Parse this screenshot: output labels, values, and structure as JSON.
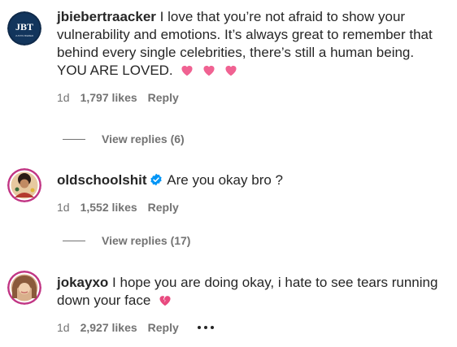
{
  "comments": [
    {
      "username": "jbiebertraacker",
      "avatar_text": "JBT",
      "avatar_subtext": "JUSTIN BIEBER",
      "text": "I love that you’re not afraid to show your vulnerability and emotions. It’s always great to remember that behind every single celebrities, there’s still a human being. YOU ARE LOVED.",
      "emoji": [
        "pink-heart-icon",
        "pink-heart-icon",
        "pink-heart-icon"
      ],
      "time": "1d",
      "likes": "1,797 likes",
      "reply_label": "Reply",
      "view_replies": "View replies (6)"
    },
    {
      "username": "oldschoolshit",
      "verified": true,
      "text": "Are you okay bro ?",
      "time": "1d",
      "likes": "1,552 likes",
      "reply_label": "Reply",
      "view_replies": "View replies (17)"
    },
    {
      "username": "jokayxo",
      "text": "I hope you are doing okay, i hate to see tears running down your face",
      "emoji": [
        "broken-heart-icon"
      ],
      "time": "1d",
      "likes": "2,927 likes",
      "reply_label": "Reply",
      "more_icon": "more-options-icon"
    }
  ],
  "colors": {
    "text": "#262626",
    "secondary": "#737373",
    "verified": "#0095f6",
    "heart_pink": "#f06292",
    "broken_heart": "#e84a7f",
    "avatar_ring": "#c13584"
  }
}
